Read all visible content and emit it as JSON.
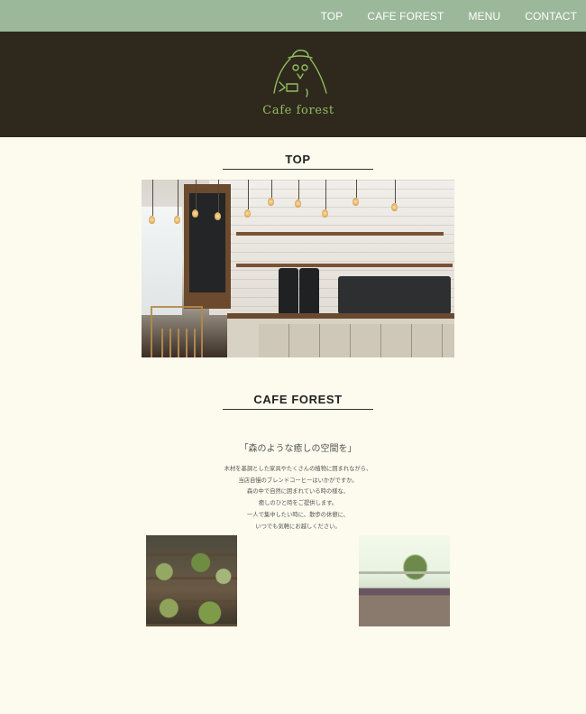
{
  "nav": {
    "items": [
      {
        "label": "TOP"
      },
      {
        "label": "CAFE FOREST"
      },
      {
        "label": "MENU"
      },
      {
        "label": "CONTACT"
      }
    ]
  },
  "header": {
    "logo_text": "Cafe forest"
  },
  "sections": {
    "top": {
      "title": "TOP"
    },
    "cafe_forest": {
      "title": "CAFE FOREST",
      "tagline": "「森のような癒しの空間を」",
      "description": [
        "木材を基調とした家具やたくさんの植物に囲まれながら、",
        "当店自慢のブレンドコーヒーはいかがですか。",
        "森の中で自然に囲まれている時の様な、",
        "癒しのひと時をご提供します。",
        "一人で集中したい時に、散歩の休憩に、",
        "いつでも気軽にお越しください。"
      ]
    }
  },
  "colors": {
    "nav_bg": "#9bb89a",
    "header_bg": "#2f281d",
    "page_bg": "#fcfbee",
    "logo_green": "#8fbf5e"
  }
}
